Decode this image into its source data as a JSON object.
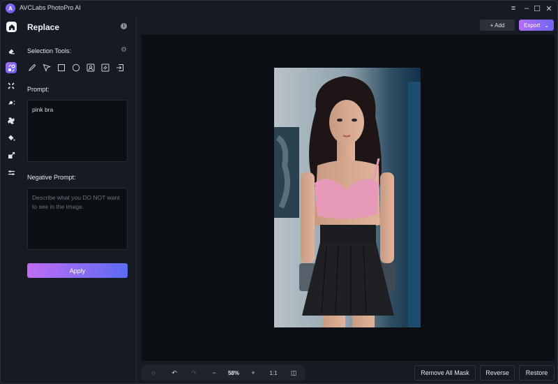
{
  "app": {
    "title": "AVCLabs PhotoPro AI",
    "logo_letter": "A"
  },
  "window_controls": {
    "menu_icon": "≡",
    "minimize_icon": "–",
    "maximize_icon": "☐",
    "close_icon": "✕"
  },
  "rail": {
    "items": [
      {
        "name": "home",
        "icon": "⌂"
      },
      {
        "name": "erase",
        "icon": "⌫"
      },
      {
        "name": "replace",
        "icon": "✦"
      },
      {
        "name": "upscale",
        "icon": "⁙"
      },
      {
        "name": "remove-background",
        "icon": "✷"
      },
      {
        "name": "colorize",
        "icon": "✣"
      },
      {
        "name": "fill",
        "icon": "◆"
      },
      {
        "name": "resize",
        "icon": "⇗"
      },
      {
        "name": "adjust",
        "icon": "⇆"
      }
    ]
  },
  "panel": {
    "title": "Replace",
    "info_icon": "i",
    "selection_tools_label": "Selection Tools:",
    "settings_icon": "⚙",
    "tools": [
      "brush",
      "lasso",
      "rectangle",
      "ellipse",
      "portrait-select",
      "object-select",
      "import-mask"
    ],
    "prompt_label": "Prompt:",
    "prompt_value": "pink bra",
    "negative_prompt_label": "Negative Prompt:",
    "negative_prompt_placeholder": "Describe what you DO NOT want to see in the image.",
    "negative_prompt_value": "",
    "apply_label": "Apply",
    "accent_start": "#c06cf4",
    "accent_end": "#5b6cf2"
  },
  "toolbar": {
    "add_label": "+ Add",
    "export_label": "Export",
    "export_chevron": "⌄"
  },
  "canvas": {
    "image_alt": "AI generated portrait of a woman in a pink bra and black pleated skirt"
  },
  "zoom_bar": {
    "reset_icon": "◌",
    "undo_icon": "↶",
    "redo_icon": "↷",
    "zoom_out_icon": "−",
    "zoom_value": "58%",
    "zoom_in_icon": "+",
    "actual_size_label": "1:1",
    "compare_icon": "◫"
  },
  "actions": {
    "remove_all_mask": "Remove All Mask",
    "reverse": "Reverse",
    "restore": "Restore"
  }
}
